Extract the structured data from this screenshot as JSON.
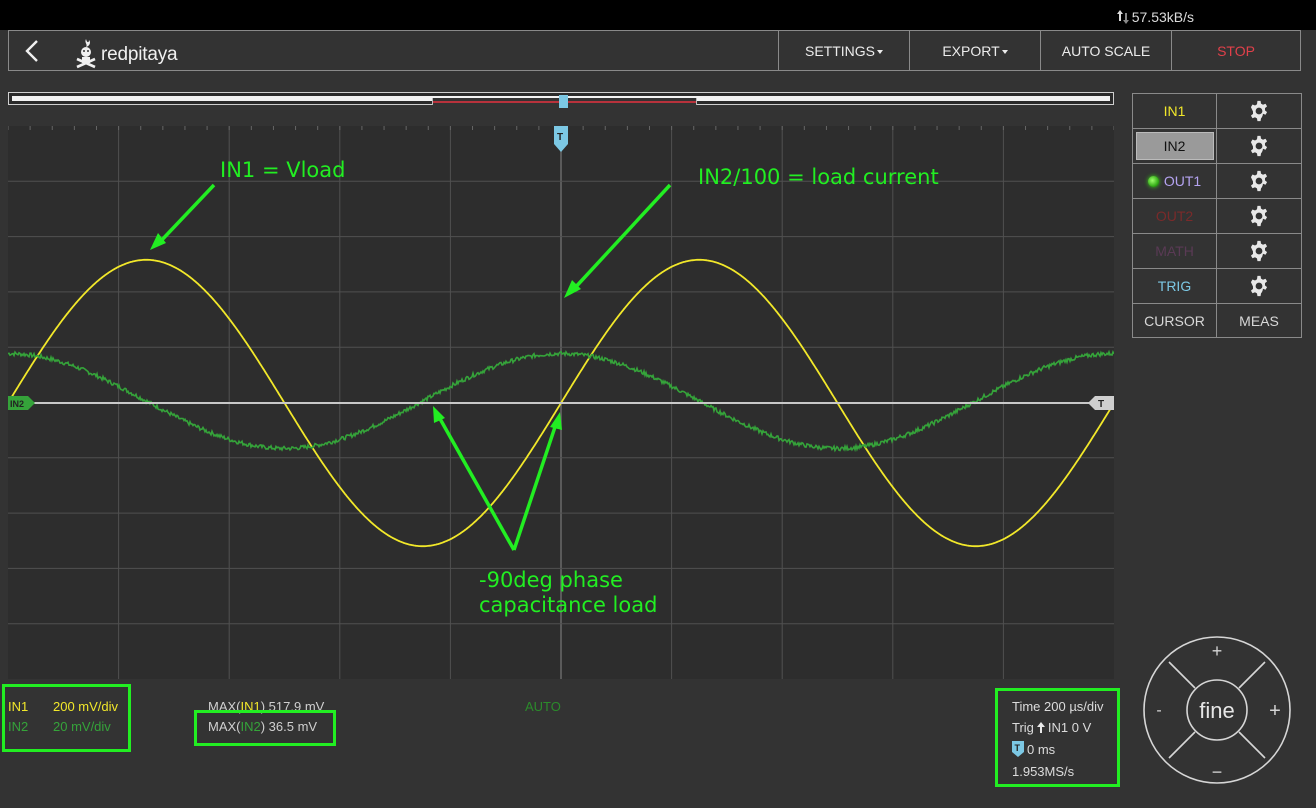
{
  "statusbar": {
    "net_rate": "57.53kB/s"
  },
  "header": {
    "logo_text": "redpitaya",
    "settings_label": "SETTINGS",
    "export_label": "EXPORT",
    "autoscale_label": "AUTO SCALE",
    "stop_label": "STOP"
  },
  "colors": {
    "in1": "#f2e82a",
    "in2": "#35a33a",
    "out1": "#b4a3f0",
    "out2": "#7a2a2a",
    "math": "#5a3a55",
    "trig": "#7cc8e4",
    "annotation": "#22ee22",
    "stop": "#e0404a"
  },
  "panel": {
    "channels": [
      {
        "label": "IN1",
        "color": "#f2e82a",
        "icon": "gear-icon"
      },
      {
        "label": "IN2",
        "color": "#111111",
        "icon": "gear-icon",
        "selected": true
      },
      {
        "label": "OUT1",
        "color": "#b4a3f0",
        "icon": "gear-icon",
        "led": true
      },
      {
        "label": "OUT2",
        "color": "#7a2a2a",
        "icon": "gear-icon"
      },
      {
        "label": "MATH",
        "color": "#5a3a55",
        "icon": "gear-icon"
      },
      {
        "label": "TRIG",
        "color": "#7cc8e4",
        "icon": "gear-icon"
      }
    ],
    "cursor_label": "CURSOR",
    "meas_label": "MEAS"
  },
  "markers": {
    "trigger_top": "T",
    "trigger_right": "T",
    "in2_offset": "IN2"
  },
  "annotations": {
    "in1": "IN1 = Vload",
    "in2": "IN2/100 = load current",
    "phase_line1": "-90deg phase",
    "phase_line2": "capacitance load"
  },
  "bottom": {
    "in1_label": "IN1",
    "in1_scale": "200 mV/div",
    "in2_label": "IN2",
    "in2_scale": "20 mV/div",
    "max_in1_prefix": "MAX(",
    "max_in1_ch": "IN1",
    "max_in1_suffix": ") 517.9 mV",
    "max_in2_prefix": "MAX(",
    "max_in2_ch": "IN2",
    "max_in2_suffix": ") 36.5 mV",
    "mode": "AUTO",
    "time_div": "Time 200 µs/div",
    "trig_prefix": "Trig",
    "trig_suffix": "IN1 0 V",
    "trig_pos_badge": "T",
    "trig_pos": "0 ms",
    "sample_rate": "1.953MS/s"
  },
  "dpad": {
    "up": "+",
    "down": "−",
    "left": "-",
    "right": "+",
    "center": "fine"
  },
  "chart_data": {
    "type": "line",
    "grid": true,
    "divisions": {
      "x": 10,
      "y": 10
    },
    "xlim": [
      -1.0,
      1.0
    ],
    "x_unit": "ms",
    "series": [
      {
        "name": "IN1",
        "color": "#f2e82a",
        "amplitude_mV": 517.9,
        "period_ms": 1.0,
        "phase": "sine crossing 0 at trigger (t=0) rising"
      },
      {
        "name": "IN2",
        "color": "#35a33a",
        "amplitude_mV": 36.5,
        "period_ms": 1.0,
        "phase": "peak at t=0 (leads IN1 by 90deg)"
      }
    ]
  }
}
